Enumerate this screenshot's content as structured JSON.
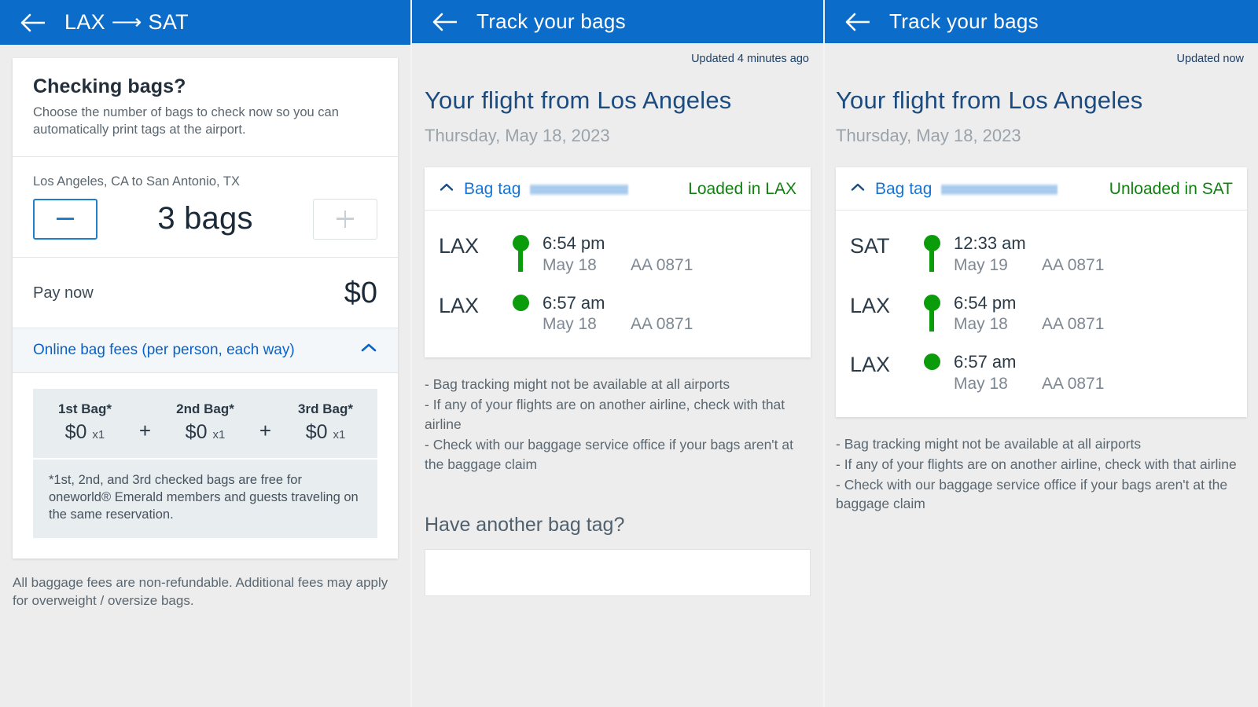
{
  "panels": {
    "bags": {
      "appbar": {
        "title": "LAX ⟶ SAT",
        "back_icon": "back-arrow-icon"
      },
      "heading": "Checking bags?",
      "subheading": "Choose the number of bags to check now so you can automatically print tags at the airport.",
      "route": "Los Angeles, CA to San Antonio, TX",
      "stepper": {
        "decrement_label": "−",
        "increment_label": "+",
        "count_label": "3 bags",
        "count_value": 3
      },
      "pay": {
        "label": "Pay now",
        "amount": "$0"
      },
      "fees": {
        "header": "Online bag fees (per person, each way)",
        "collapse_icon": "chevron-up-icon",
        "items": [
          {
            "name": "1st Bag*",
            "price": "$0",
            "qty": "x1"
          },
          {
            "name": "2nd Bag*",
            "price": "$0",
            "qty": "x1"
          },
          {
            "name": "3rd Bag*",
            "price": "$0",
            "qty": "x1"
          }
        ],
        "separator": "+",
        "note": "*1st, 2nd, and 3rd checked bags are free for oneworld® Emerald members and guests traveling on the same reservation."
      },
      "footnote": "All baggage fees are non-refundable. Additional fees may apply for overweight / oversize bags."
    },
    "track_mid": {
      "appbar": {
        "title": "Track your bags",
        "back_icon": "back-arrow-icon"
      },
      "updated": "Updated 4 minutes ago",
      "flight_title": "Your flight from Los Angeles",
      "flight_date": "Thursday, May 18, 2023",
      "bag": {
        "collapse_icon": "chevron-up-icon",
        "tag_label": "Bag tag",
        "tag_value_redacted": true,
        "status": "Loaded in LAX",
        "status_color": "#118011",
        "legs": [
          {
            "code": "LAX",
            "time": "6:54 pm",
            "date": "May 18",
            "flight": "AA 0871"
          },
          {
            "code": "LAX",
            "time": "6:57 am",
            "date": "May 18",
            "flight": "AA 0871"
          }
        ]
      },
      "notes": [
        "- Bag tracking might not be available at all airports",
        "- If any of your flights are on another airline, check with that airline",
        "- Check with our baggage service office if your bags aren't at the baggage claim"
      ],
      "another_tag_heading": "Have another bag tag?",
      "another_tag_input_value": ""
    },
    "track_right": {
      "appbar": {
        "title": "Track your bags",
        "back_icon": "back-arrow-icon"
      },
      "updated": "Updated now",
      "flight_title": "Your flight from Los Angeles",
      "flight_date": "Thursday, May 18, 2023",
      "bag": {
        "collapse_icon": "chevron-up-icon",
        "tag_label": "Bag tag",
        "tag_value_redacted": true,
        "status": "Unloaded in SAT",
        "status_color": "#118011",
        "legs": [
          {
            "code": "SAT",
            "time": "12:33 am",
            "date": "May 19",
            "flight": "AA 0871"
          },
          {
            "code": "LAX",
            "time": "6:54 pm",
            "date": "May 18",
            "flight": "AA 0871"
          },
          {
            "code": "LAX",
            "time": "6:57 am",
            "date": "May 18",
            "flight": "AA 0871"
          }
        ]
      },
      "notes": [
        "- Bag tracking might not be available at all airports",
        "- If any of your flights are on another airline, check with that airline",
        "- Check with our baggage service office if your bags aren't at the baggage claim"
      ]
    }
  },
  "colors": {
    "appbar_blue": "#0b6dc9",
    "link_blue": "#0a62c7",
    "status_green": "#118011",
    "rail_green": "#0a9c0a",
    "page_bg": "#ededed",
    "card_bg": "#ffffff",
    "muted_text": "#5b6770",
    "heading_navy": "#1c4b80"
  }
}
